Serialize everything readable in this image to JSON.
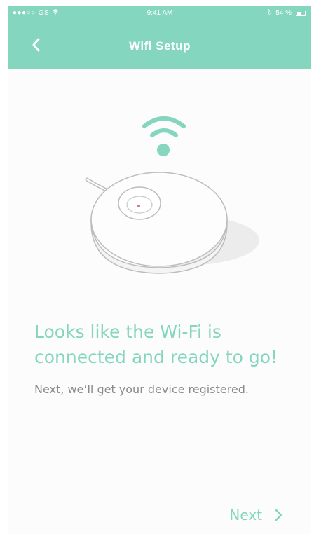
{
  "status_bar": {
    "carrier": "GS",
    "time": "9:41 AM",
    "battery": "54 %"
  },
  "nav": {
    "title": "Wifi Setup"
  },
  "main": {
    "headline_line1": "Looks like the Wi-Fi is",
    "headline_line2": "connected and ready to go!",
    "subtext": "Next, we’ll get your device registered."
  },
  "footer": {
    "next_label": "Next"
  },
  "colors": {
    "accent": "#84d6be",
    "subtext": "#8a8a8a"
  },
  "icons": [
    "chevron-left-icon",
    "wifi-icon",
    "device-illustration",
    "chevron-right-icon"
  ]
}
